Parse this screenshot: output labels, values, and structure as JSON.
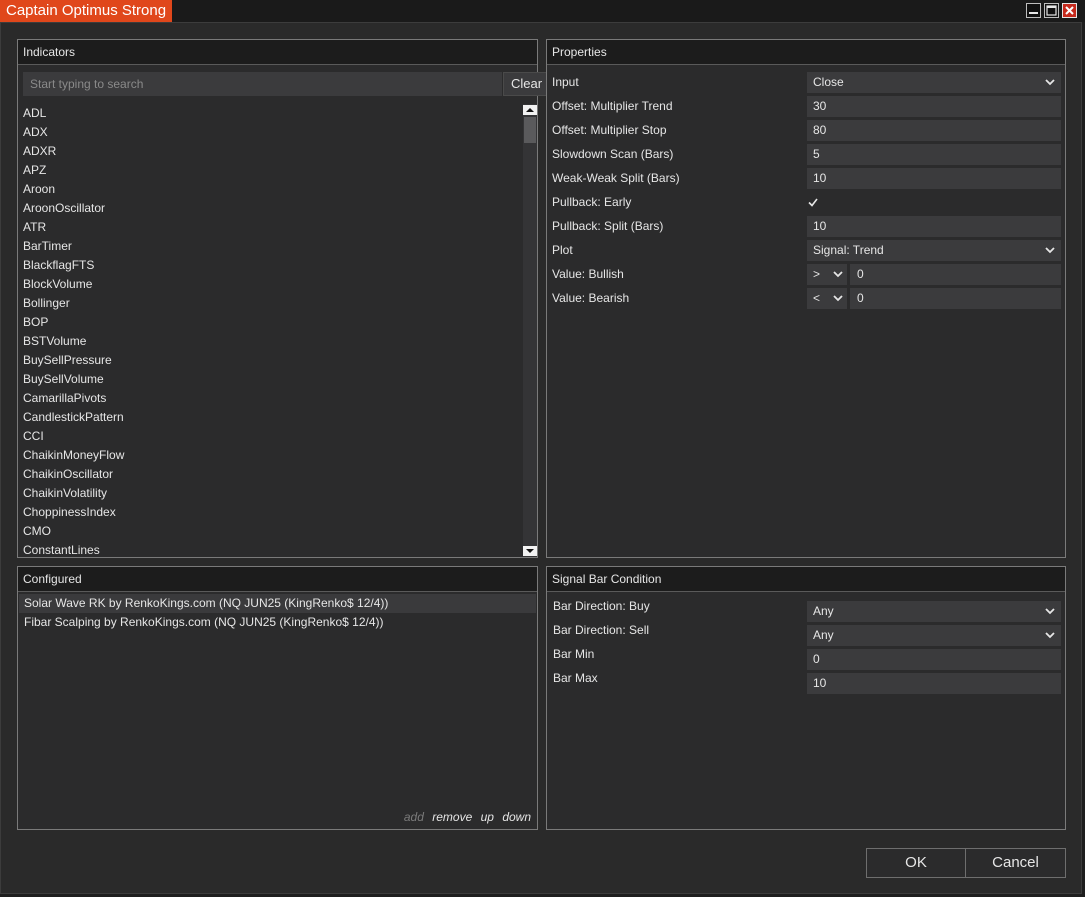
{
  "window": {
    "title": "Captain Optimus Strong",
    "controls": [
      "minimize-icon",
      "maximize-icon",
      "close-icon"
    ]
  },
  "indicators": {
    "header": "Indicators",
    "search_placeholder": "Start typing to search",
    "search_value": "",
    "clear_label": "Clear",
    "items": [
      "ADL",
      "ADX",
      "ADXR",
      "APZ",
      "Aroon",
      "AroonOscillator",
      "ATR",
      "BarTimer",
      "BlackflagFTS",
      "BlockVolume",
      "Bollinger",
      "BOP",
      "BSTVolume",
      "BuySellPressure",
      "BuySellVolume",
      "CamarillaPivots",
      "CandlestickPattern",
      "CCI",
      "ChaikinMoneyFlow",
      "ChaikinOscillator",
      "ChaikinVolatility",
      "ChoppinessIndex",
      "CMO",
      "ConstantLines"
    ]
  },
  "properties": {
    "header": "Properties",
    "input": {
      "label": "Input",
      "value": "Close"
    },
    "offset_trend": {
      "label": "Offset: Multiplier Trend",
      "value": "30"
    },
    "offset_stop": {
      "label": "Offset: Multiplier Stop",
      "value": "80"
    },
    "slowdown": {
      "label": "Slowdown Scan (Bars)",
      "value": "5"
    },
    "weak_split": {
      "label": "Weak-Weak Split (Bars)",
      "value": "10"
    },
    "pullback_early": {
      "label": "Pullback: Early",
      "checked": true
    },
    "pullback_split": {
      "label": "Pullback: Split (Bars)",
      "value": "10"
    },
    "plot": {
      "label": "Plot",
      "value": "Signal: Trend"
    },
    "value_bullish": {
      "label": "Value: Bullish",
      "operator": ">",
      "value": "0"
    },
    "value_bearish": {
      "label": "Value: Bearish",
      "operator": "<",
      "value": "0"
    }
  },
  "configured": {
    "header": "Configured",
    "items": [
      "Solar Wave RK by RenkoKings.com (NQ JUN25 (KingRenko$ 12/4))",
      "Fibar Scalping by RenkoKings.com (NQ JUN25 (KingRenko$ 12/4))"
    ],
    "selected_index": 0,
    "actions": {
      "add": "add",
      "remove": "remove",
      "up": "up",
      "down": "down"
    }
  },
  "signal": {
    "header": "Signal Bar Condition",
    "dir_buy": {
      "label": "Bar Direction: Buy",
      "value": "Any"
    },
    "dir_sell": {
      "label": "Bar Direction: Sell",
      "value": "Any"
    },
    "bar_min": {
      "label": "Bar Min",
      "value": "0"
    },
    "bar_max": {
      "label": "Bar Max",
      "value": "10"
    }
  },
  "buttons": {
    "ok": "OK",
    "cancel": "Cancel"
  },
  "colors": {
    "accent": "#e0471b",
    "panel": "#2b2b2c",
    "field": "#3b3b3d",
    "text": "#e6e6e6"
  }
}
